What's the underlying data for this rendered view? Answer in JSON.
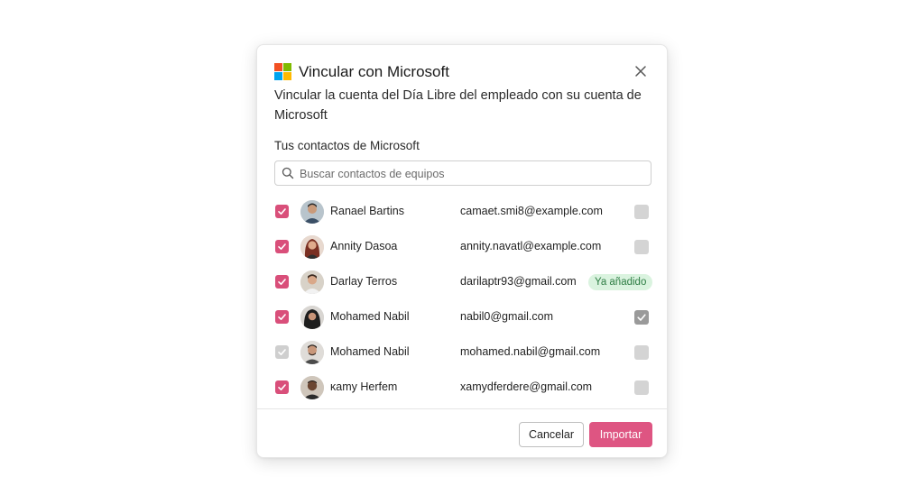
{
  "dialog": {
    "title": "Vincular con Microsoft",
    "description": "Vincular la cuenta del Día Libre del empleado con su cuenta de Microsoft",
    "section_label": "Tus contactos de Microsoft",
    "search_placeholder": "Buscar contactos de equipos",
    "cancel_label": "Cancelar",
    "import_label": "Importar"
  },
  "colors": {
    "accent": "#d94f7a",
    "ms_red": "#f25022",
    "ms_green": "#7fba00",
    "ms_blue": "#00a4ef",
    "ms_yellow": "#ffb900"
  },
  "contacts": [
    {
      "name": "Ranael Bartins",
      "email": "camaet.smi8@example.com",
      "selected": true,
      "status": "unchecked"
    },
    {
      "name": "Annity Dasoa",
      "email": "annity.navatl@example.com",
      "selected": true,
      "status": "unchecked"
    },
    {
      "name": "Darlay Terros",
      "email": "darilaptr93@gmail.com",
      "selected": true,
      "status": "badge",
      "badge": "Ya añadido"
    },
    {
      "name": "Mohamed Nabil",
      "email": "nabil0@gmail.com",
      "selected": true,
      "status": "checked"
    },
    {
      "name": "Mohamed Nabil",
      "email": "mohamed.nabil@gmail.com",
      "selected": false,
      "status": "unchecked"
    },
    {
      "name": "ĸamy Herfem",
      "email": "xamydferdere@gmail.com",
      "selected": true,
      "status": "unchecked"
    }
  ]
}
